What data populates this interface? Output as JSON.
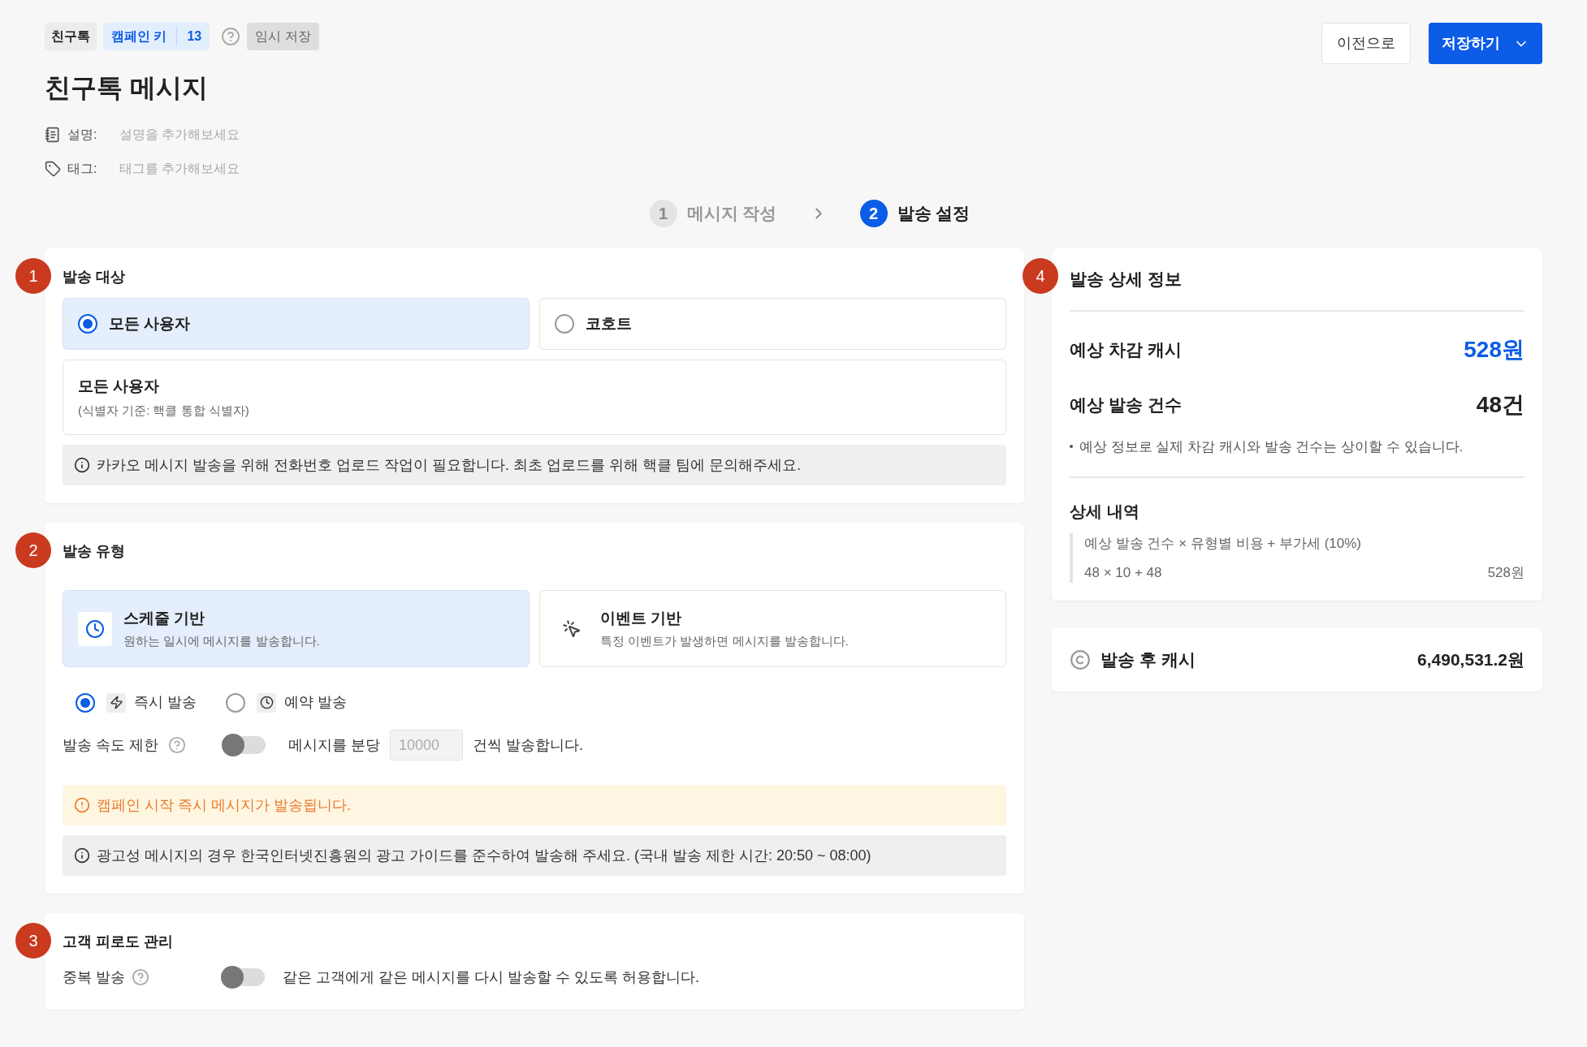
{
  "header": {
    "channel": "친구톡",
    "campaign_key_label": "캠페인 키",
    "campaign_key": "13",
    "status": "임시 저장"
  },
  "title": "친구톡 메시지",
  "meta": [
    {
      "kind": "description",
      "label": "설명:",
      "placeholder": "설명을 추가해보세요"
    },
    {
      "kind": "tag",
      "label": "태그:",
      "placeholder": "태그를 추가해보세요"
    }
  ],
  "actions": {
    "back": "이전으로",
    "save": "저장하기"
  },
  "steps": [
    {
      "number": "1",
      "label": "메시지 작성",
      "selected": false
    },
    {
      "number": "2",
      "label": "발송 설정",
      "selected": true
    }
  ],
  "target": {
    "marker": "1",
    "title": "발송 대상",
    "options": [
      {
        "label": "모든 사용자",
        "selected": true
      },
      {
        "label": "코호트",
        "selected": false
      }
    ],
    "detail": {
      "title": "모든 사용자",
      "subtitle": "(식별자 기준: 핵클 통합 식별자)"
    },
    "notice": "카카오 메시지 발송을 위해 전화번호 업로드 작업이 필요합니다. 최초 업로드를 위해 핵클 팀에 문의해주세요."
  },
  "send_type": {
    "marker": "2",
    "title": "발송 유형",
    "types": [
      {
        "kind": "schedule",
        "title": "스케줄 기반",
        "description": "원하는 일시에 메시지를 발송합니다.",
        "selected": true
      },
      {
        "kind": "event",
        "title": "이벤트 기반",
        "description": "특정 이벤트가 발생하면 메시지를 발송합니다.",
        "selected": false
      }
    ],
    "timing": [
      {
        "kind": "instant",
        "label": "즉시 발송",
        "selected": true
      },
      {
        "kind": "reserved",
        "label": "예약 발송",
        "selected": false
      }
    ],
    "rate_limit": {
      "label": "발송 속도 제한",
      "on": false,
      "prefix": "메시지를 분당",
      "placeholder": "10000",
      "suffix": "건씩 발송합니다."
    },
    "warning": "캠페인 시작 즉시 메시지가 발송됩니다.",
    "notice": "광고성 메시지의 경우 한국인터넷진흥원의 광고 가이드를 준수하여 발송해 주세요. (국내 발송 제한 시간: 20:50 ~ 08:00)"
  },
  "fatigue": {
    "marker": "3",
    "title": "고객 피로도 관리",
    "duplicate": {
      "label": "중복 발송",
      "on": false,
      "description": "같은 고객에게 같은 메시지를 다시 발송할 수 있도록 허용합니다."
    }
  },
  "summary": {
    "marker": "4",
    "title": "발송 상세 정보",
    "rows": [
      {
        "kind": "highlight",
        "label": "예상 차감 캐시",
        "value": "528원"
      },
      {
        "kind": "plain",
        "label": "예상 발송 건수",
        "value": "48건"
      }
    ],
    "note": "예상 정보로 실제 차감 캐시와 발송 건수는 상이할 수 있습니다.",
    "breakdown": {
      "title": "상세 내역",
      "formula": "예상 발송 건수 × 유형별 비용 + 부가세 (10%)",
      "calculation": "48 × 10 + 48",
      "total": "528원"
    }
  },
  "balance": {
    "label": "발송 후 캐시",
    "value": "6,490,531.2원"
  }
}
